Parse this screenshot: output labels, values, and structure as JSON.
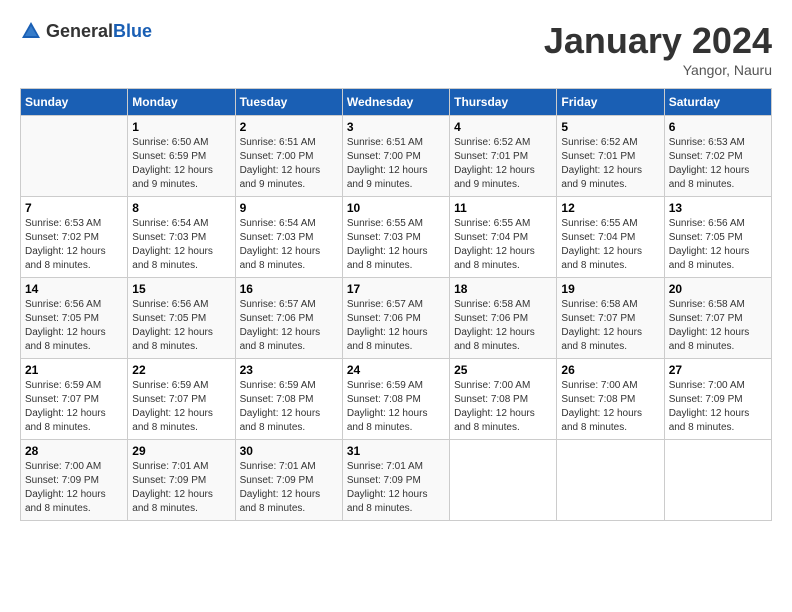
{
  "logo": {
    "text_general": "General",
    "text_blue": "Blue"
  },
  "title": "January 2024",
  "location": "Yangor, Nauru",
  "days_of_week": [
    "Sunday",
    "Monday",
    "Tuesday",
    "Wednesday",
    "Thursday",
    "Friday",
    "Saturday"
  ],
  "weeks": [
    [
      {
        "day": "",
        "sunrise": "",
        "sunset": "",
        "daylight": ""
      },
      {
        "day": "1",
        "sunrise": "Sunrise: 6:50 AM",
        "sunset": "Sunset: 6:59 PM",
        "daylight": "Daylight: 12 hours and 9 minutes."
      },
      {
        "day": "2",
        "sunrise": "Sunrise: 6:51 AM",
        "sunset": "Sunset: 7:00 PM",
        "daylight": "Daylight: 12 hours and 9 minutes."
      },
      {
        "day": "3",
        "sunrise": "Sunrise: 6:51 AM",
        "sunset": "Sunset: 7:00 PM",
        "daylight": "Daylight: 12 hours and 9 minutes."
      },
      {
        "day": "4",
        "sunrise": "Sunrise: 6:52 AM",
        "sunset": "Sunset: 7:01 PM",
        "daylight": "Daylight: 12 hours and 9 minutes."
      },
      {
        "day": "5",
        "sunrise": "Sunrise: 6:52 AM",
        "sunset": "Sunset: 7:01 PM",
        "daylight": "Daylight: 12 hours and 9 minutes."
      },
      {
        "day": "6",
        "sunrise": "Sunrise: 6:53 AM",
        "sunset": "Sunset: 7:02 PM",
        "daylight": "Daylight: 12 hours and 8 minutes."
      }
    ],
    [
      {
        "day": "7",
        "sunrise": "Sunrise: 6:53 AM",
        "sunset": "Sunset: 7:02 PM",
        "daylight": "Daylight: 12 hours and 8 minutes."
      },
      {
        "day": "8",
        "sunrise": "Sunrise: 6:54 AM",
        "sunset": "Sunset: 7:03 PM",
        "daylight": "Daylight: 12 hours and 8 minutes."
      },
      {
        "day": "9",
        "sunrise": "Sunrise: 6:54 AM",
        "sunset": "Sunset: 7:03 PM",
        "daylight": "Daylight: 12 hours and 8 minutes."
      },
      {
        "day": "10",
        "sunrise": "Sunrise: 6:55 AM",
        "sunset": "Sunset: 7:03 PM",
        "daylight": "Daylight: 12 hours and 8 minutes."
      },
      {
        "day": "11",
        "sunrise": "Sunrise: 6:55 AM",
        "sunset": "Sunset: 7:04 PM",
        "daylight": "Daylight: 12 hours and 8 minutes."
      },
      {
        "day": "12",
        "sunrise": "Sunrise: 6:55 AM",
        "sunset": "Sunset: 7:04 PM",
        "daylight": "Daylight: 12 hours and 8 minutes."
      },
      {
        "day": "13",
        "sunrise": "Sunrise: 6:56 AM",
        "sunset": "Sunset: 7:05 PM",
        "daylight": "Daylight: 12 hours and 8 minutes."
      }
    ],
    [
      {
        "day": "14",
        "sunrise": "Sunrise: 6:56 AM",
        "sunset": "Sunset: 7:05 PM",
        "daylight": "Daylight: 12 hours and 8 minutes."
      },
      {
        "day": "15",
        "sunrise": "Sunrise: 6:56 AM",
        "sunset": "Sunset: 7:05 PM",
        "daylight": "Daylight: 12 hours and 8 minutes."
      },
      {
        "day": "16",
        "sunrise": "Sunrise: 6:57 AM",
        "sunset": "Sunset: 7:06 PM",
        "daylight": "Daylight: 12 hours and 8 minutes."
      },
      {
        "day": "17",
        "sunrise": "Sunrise: 6:57 AM",
        "sunset": "Sunset: 7:06 PM",
        "daylight": "Daylight: 12 hours and 8 minutes."
      },
      {
        "day": "18",
        "sunrise": "Sunrise: 6:58 AM",
        "sunset": "Sunset: 7:06 PM",
        "daylight": "Daylight: 12 hours and 8 minutes."
      },
      {
        "day": "19",
        "sunrise": "Sunrise: 6:58 AM",
        "sunset": "Sunset: 7:07 PM",
        "daylight": "Daylight: 12 hours and 8 minutes."
      },
      {
        "day": "20",
        "sunrise": "Sunrise: 6:58 AM",
        "sunset": "Sunset: 7:07 PM",
        "daylight": "Daylight: 12 hours and 8 minutes."
      }
    ],
    [
      {
        "day": "21",
        "sunrise": "Sunrise: 6:59 AM",
        "sunset": "Sunset: 7:07 PM",
        "daylight": "Daylight: 12 hours and 8 minutes."
      },
      {
        "day": "22",
        "sunrise": "Sunrise: 6:59 AM",
        "sunset": "Sunset: 7:07 PM",
        "daylight": "Daylight: 12 hours and 8 minutes."
      },
      {
        "day": "23",
        "sunrise": "Sunrise: 6:59 AM",
        "sunset": "Sunset: 7:08 PM",
        "daylight": "Daylight: 12 hours and 8 minutes."
      },
      {
        "day": "24",
        "sunrise": "Sunrise: 6:59 AM",
        "sunset": "Sunset: 7:08 PM",
        "daylight": "Daylight: 12 hours and 8 minutes."
      },
      {
        "day": "25",
        "sunrise": "Sunrise: 7:00 AM",
        "sunset": "Sunset: 7:08 PM",
        "daylight": "Daylight: 12 hours and 8 minutes."
      },
      {
        "day": "26",
        "sunrise": "Sunrise: 7:00 AM",
        "sunset": "Sunset: 7:08 PM",
        "daylight": "Daylight: 12 hours and 8 minutes."
      },
      {
        "day": "27",
        "sunrise": "Sunrise: 7:00 AM",
        "sunset": "Sunset: 7:09 PM",
        "daylight": "Daylight: 12 hours and 8 minutes."
      }
    ],
    [
      {
        "day": "28",
        "sunrise": "Sunrise: 7:00 AM",
        "sunset": "Sunset: 7:09 PM",
        "daylight": "Daylight: 12 hours and 8 minutes."
      },
      {
        "day": "29",
        "sunrise": "Sunrise: 7:01 AM",
        "sunset": "Sunset: 7:09 PM",
        "daylight": "Daylight: 12 hours and 8 minutes."
      },
      {
        "day": "30",
        "sunrise": "Sunrise: 7:01 AM",
        "sunset": "Sunset: 7:09 PM",
        "daylight": "Daylight: 12 hours and 8 minutes."
      },
      {
        "day": "31",
        "sunrise": "Sunrise: 7:01 AM",
        "sunset": "Sunset: 7:09 PM",
        "daylight": "Daylight: 12 hours and 8 minutes."
      },
      {
        "day": "",
        "sunrise": "",
        "sunset": "",
        "daylight": ""
      },
      {
        "day": "",
        "sunrise": "",
        "sunset": "",
        "daylight": ""
      },
      {
        "day": "",
        "sunrise": "",
        "sunset": "",
        "daylight": ""
      }
    ]
  ]
}
